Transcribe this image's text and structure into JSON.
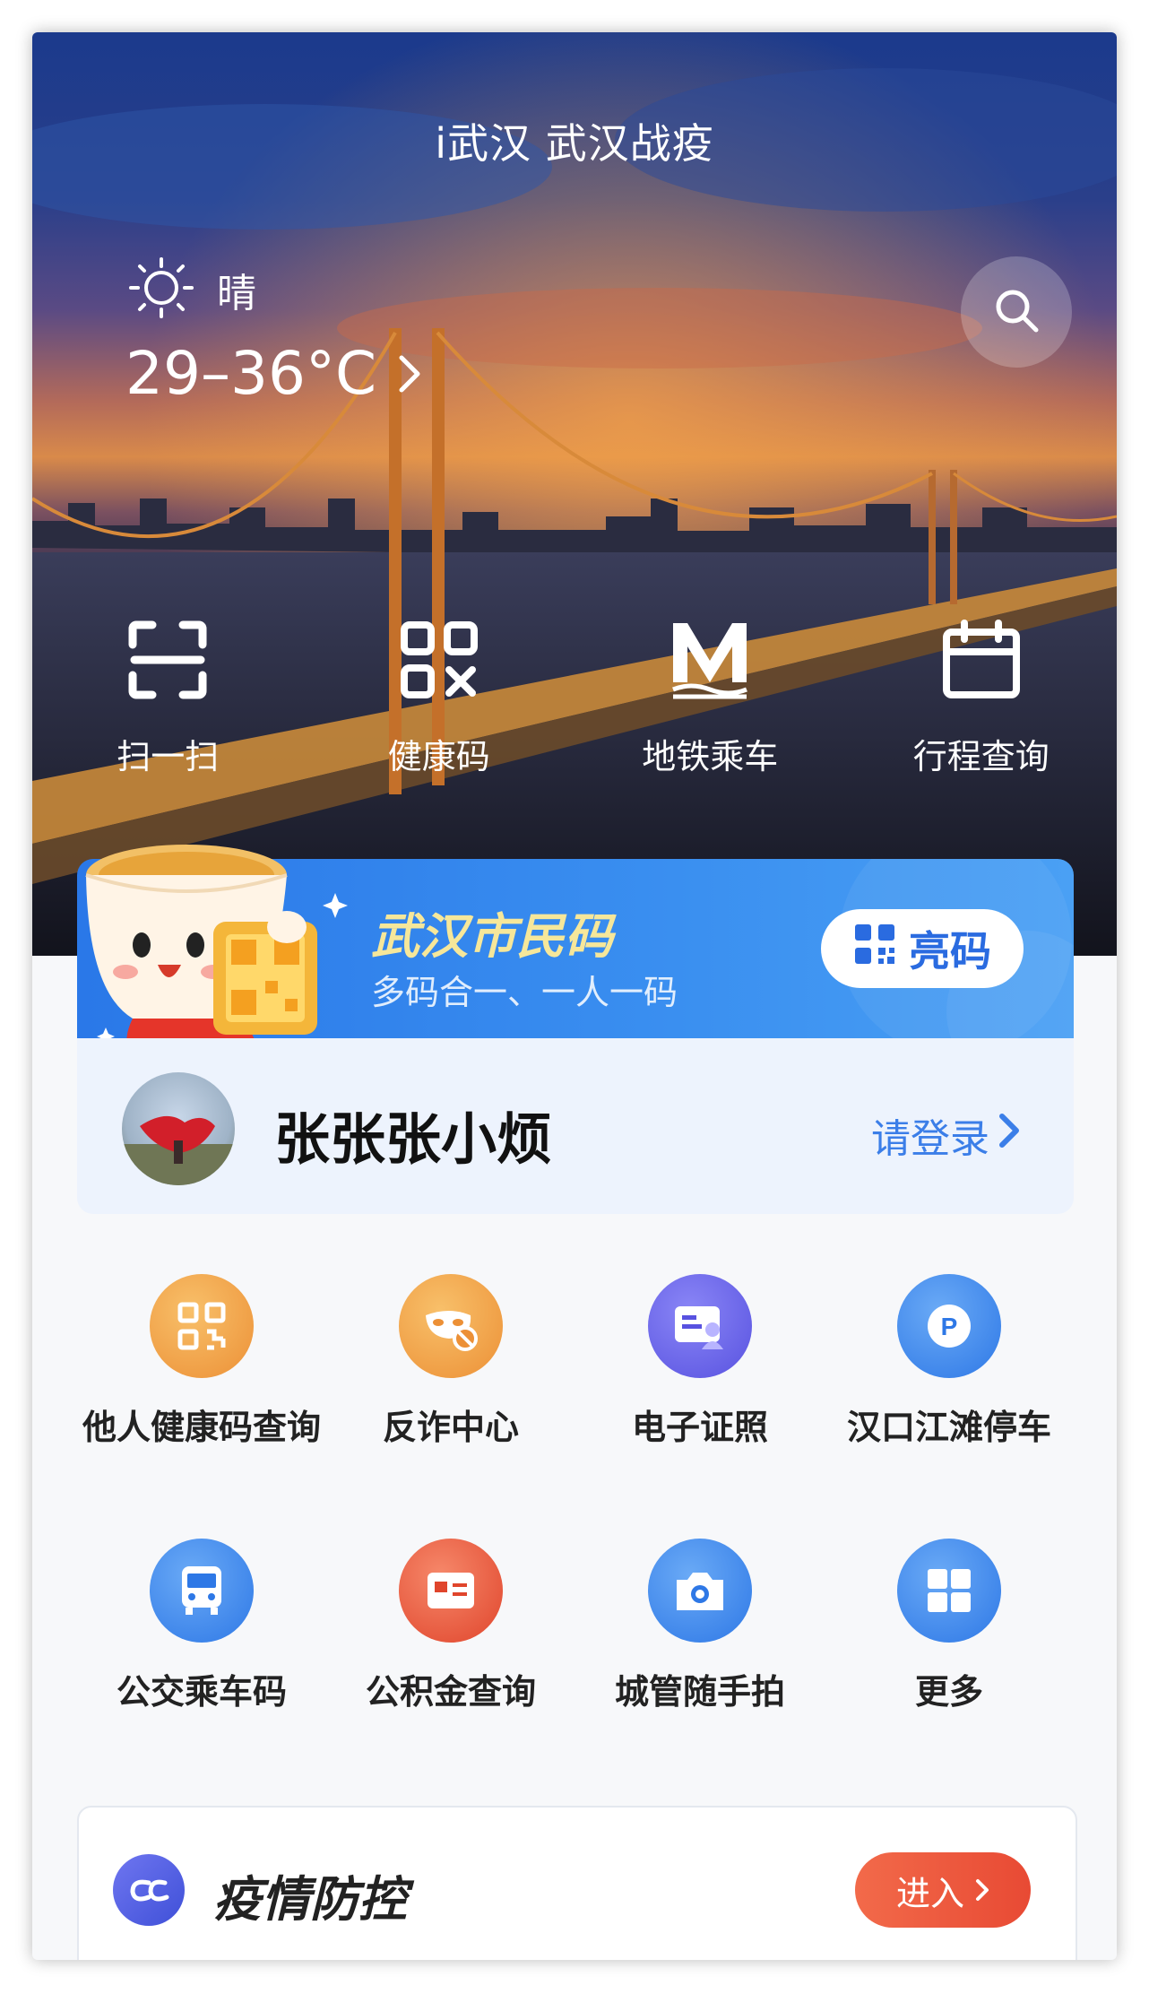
{
  "header": {
    "app_title": "i武汉 武汉战疫"
  },
  "weather": {
    "condition": "晴",
    "temperature": "29–36°C"
  },
  "quick_actions": [
    {
      "label": "扫一扫",
      "icon": "scan-icon"
    },
    {
      "label": "健康码",
      "icon": "qr-code-icon"
    },
    {
      "label": "地铁乘车",
      "icon": "metro-icon"
    },
    {
      "label": "行程查询",
      "icon": "calendar-icon"
    }
  ],
  "citizen_code": {
    "title": "武汉市民码",
    "subtitle": "多码合一、一人一码",
    "button_label": "亮码"
  },
  "user": {
    "name": "张张张小烦",
    "login_label": "请登录"
  },
  "services": [
    {
      "label": "他人健康码查询",
      "icon": "qr-query-icon",
      "color": "#f0a24a"
    },
    {
      "label": "反诈中心",
      "icon": "mask-icon",
      "color": "#f0a24a"
    },
    {
      "label": "电子证照",
      "icon": "id-card-icon",
      "color": "#6a68ea"
    },
    {
      "label": "汉口江滩停车",
      "icon": "parking-icon",
      "color": "#3d8ef0"
    },
    {
      "label": "公交乘车码",
      "icon": "bus-icon",
      "color": "#3d8ef0"
    },
    {
      "label": "公积金查询",
      "icon": "fund-card-icon",
      "color": "#ec5b3e"
    },
    {
      "label": "城管随手拍",
      "icon": "camera-icon",
      "color": "#3d8ef0"
    },
    {
      "label": "更多",
      "icon": "grid-icon",
      "color": "#3d8ef0"
    }
  ],
  "epidemic": {
    "title": "疫情防控",
    "enter_label": "进入"
  }
}
